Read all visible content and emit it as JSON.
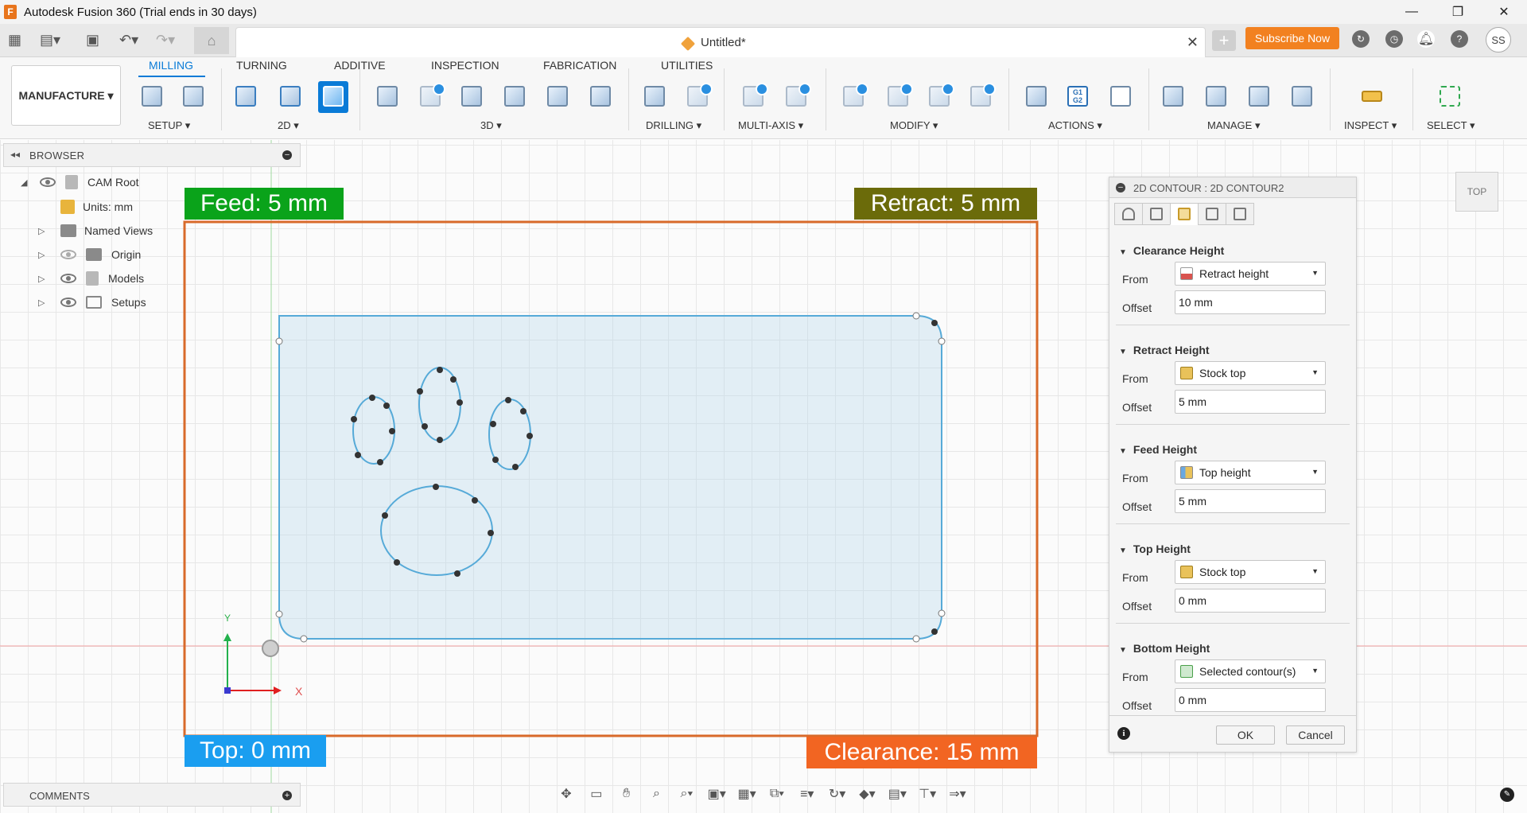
{
  "window": {
    "title": "Autodesk Fusion 360 (Trial ends in 30 days)",
    "app_icon": "F",
    "controls": [
      "—",
      "❐",
      "✕"
    ]
  },
  "quickbar": {
    "doc_title": "Untitled*",
    "subscribe_label": "Subscribe Now",
    "avatar_initials": "SS"
  },
  "ribbon": {
    "workspace": "MANUFACTURE ▾",
    "tabs": [
      "MILLING",
      "TURNING",
      "ADDITIVE",
      "INSPECTION",
      "FABRICATION",
      "UTILITIES"
    ],
    "active_tab": "MILLING",
    "groups": [
      "SETUP ▾",
      "2D ▾",
      "3D ▾",
      "DRILLING ▾",
      "MULTI-AXIS ▾",
      "MODIFY ▾",
      "ACTIONS ▾",
      "MANAGE ▾",
      "INSPECT ▾",
      "SELECT ▾"
    ],
    "actions_icon_text": "G1\nG2"
  },
  "browser": {
    "title": "BROWSER",
    "items": [
      {
        "label": "CAM Root"
      },
      {
        "label": "Units: mm"
      },
      {
        "label": "Named Views"
      },
      {
        "label": "Origin"
      },
      {
        "label": "Models"
      },
      {
        "label": "Setups"
      }
    ]
  },
  "viewport": {
    "labels": {
      "feed": "Feed: 5 mm",
      "retract": "Retract: 5 mm",
      "top": "Top: 0 mm",
      "clearance": "Clearance: 15 mm"
    },
    "label_colors": {
      "feed": "#0aa31a",
      "retract": "#6b6b0a",
      "top": "#1a9ef0",
      "clearance": "#f26522"
    },
    "axis_labels": {
      "x": "X",
      "y": "Y"
    },
    "viewcube": "TOP"
  },
  "panel": {
    "title": "2D CONTOUR : 2D CONTOUR2",
    "sections": [
      {
        "title": "Clearance Height",
        "from_label": "From",
        "from_value": "Retract height",
        "offset_label": "Offset",
        "offset_value": "10 mm"
      },
      {
        "title": "Retract Height",
        "from_label": "From",
        "from_value": "Stock top",
        "offset_label": "Offset",
        "offset_value": "5 mm"
      },
      {
        "title": "Feed Height",
        "from_label": "From",
        "from_value": "Top height",
        "offset_label": "Offset",
        "offset_value": "5 mm"
      },
      {
        "title": "Top Height",
        "from_label": "From",
        "from_value": "Stock top",
        "offset_label": "Offset",
        "offset_value": "0 mm"
      },
      {
        "title": "Bottom Height",
        "from_label": "From",
        "from_value": "Selected contour(s)",
        "offset_label": "Offset",
        "offset_value": "0 mm"
      }
    ],
    "ok_label": "OK",
    "cancel_label": "Cancel"
  },
  "comments": {
    "title": "COMMENTS"
  }
}
